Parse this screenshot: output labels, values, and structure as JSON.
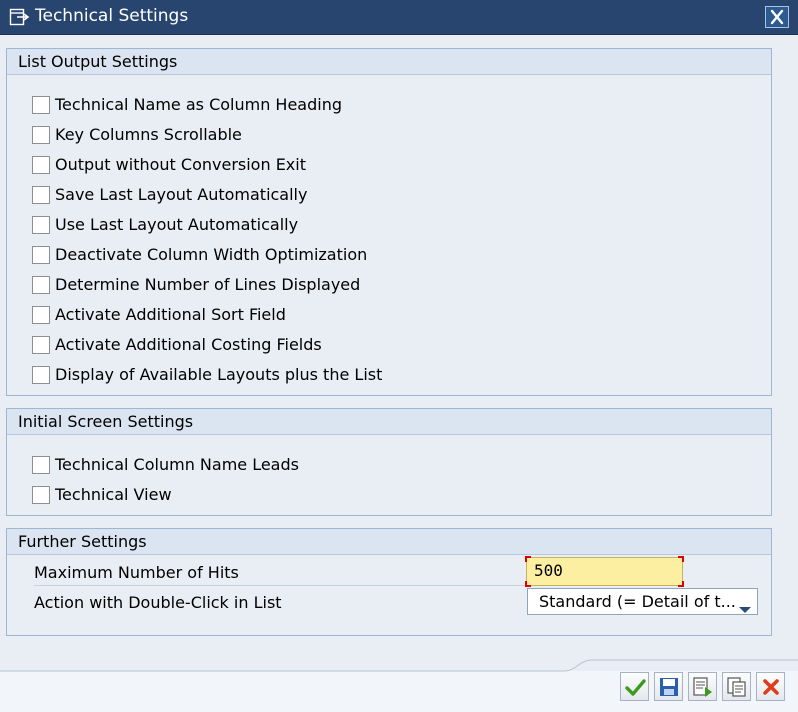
{
  "window": {
    "title": "Technical Settings",
    "title_icon": "settings-dialog-icon",
    "close_icon": "close-icon"
  },
  "groups": {
    "list_output": {
      "title": "List Output Settings",
      "items": [
        {
          "label": "Technical Name as Column Heading",
          "checked": false
        },
        {
          "label": "Key Columns Scrollable",
          "checked": false
        },
        {
          "label": "Output without Conversion Exit",
          "checked": false
        },
        {
          "label": "Save Last Layout Automatically",
          "checked": false
        },
        {
          "label": "Use Last Layout Automatically",
          "checked": false
        },
        {
          "label": "Deactivate Column Width Optimization",
          "checked": false
        },
        {
          "label": "Determine Number of Lines Displayed",
          "checked": false
        },
        {
          "label": "Activate Additional Sort Field",
          "checked": false
        },
        {
          "label": "Activate Additional Costing Fields",
          "checked": false
        },
        {
          "label": "Display of Available Layouts plus the List",
          "checked": false
        }
      ]
    },
    "initial_screen": {
      "title": "Initial Screen Settings",
      "items": [
        {
          "label": "Technical Column Name Leads",
          "checked": false
        },
        {
          "label": "Technical View",
          "checked": false
        }
      ]
    },
    "further": {
      "title": "Further Settings",
      "max_hits_label": "Maximum Number of Hits",
      "max_hits_value": "500",
      "double_click_label": "Action with Double-Click in List",
      "double_click_value": "Standard (= Detail of t..."
    }
  },
  "toolbar": {
    "buttons": [
      {
        "icon": "checkmark-icon",
        "color": "#3c9a1e"
      },
      {
        "icon": "save-icon",
        "color": "#2a5fb0"
      },
      {
        "icon": "save-as-icon",
        "color": "#3c9a1e"
      },
      {
        "icon": "copy-settings-icon",
        "color": "#555555"
      },
      {
        "icon": "cancel-icon",
        "color": "#e03c1c"
      }
    ]
  },
  "colors": {
    "titlebar": "#27456f",
    "background": "#e9eef5",
    "input_highlight": "#fcefa1",
    "required_marker": "#e00000"
  }
}
